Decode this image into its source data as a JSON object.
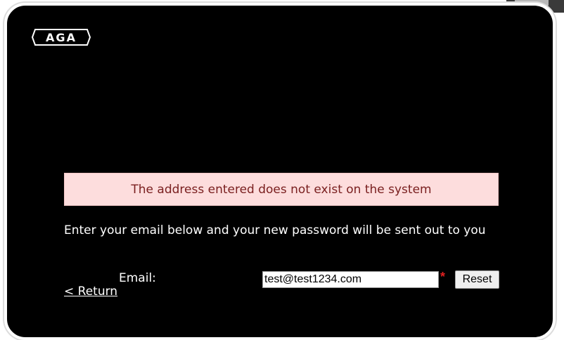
{
  "brand": {
    "logo_text": "AGA"
  },
  "colors": {
    "background": "#000000",
    "frame_border": "#ffffff",
    "error_background": "#fddddd",
    "error_text": "#7a2020",
    "required_star": "#e02020"
  },
  "error": {
    "message": "The address entered does not exist on the system"
  },
  "form": {
    "instructions": "Enter your email below and your new password will be sent out to you",
    "email_label": "Email:",
    "email_value": "test@test1234.com",
    "required_marker": "*",
    "reset_label": "Reset"
  },
  "nav": {
    "return_label": "< Return"
  }
}
